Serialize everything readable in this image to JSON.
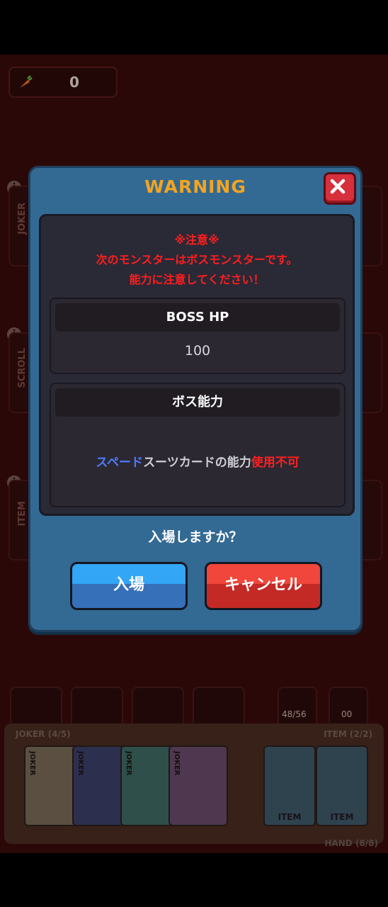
{
  "background": {
    "carrot_count": "0",
    "panels": {
      "joker": "JOKER",
      "scroll": "SCROLL",
      "item": "ITEM"
    },
    "info_icon": "i",
    "deck": {
      "count": "48/56"
    },
    "discard": {
      "count": "00"
    },
    "tray": {
      "joker_title": "JOKER (4/5)",
      "item_title": "ITEM (2/2)",
      "hand_title": "HAND (8/8)",
      "joker_card_label": "JOKER",
      "item_card_label": "ITEM"
    }
  },
  "modal": {
    "title": "WARNING",
    "notice": {
      "line1": "※注意※",
      "line2": "次のモンスターはボスモンスターです。",
      "line3": "能力に注意してください！"
    },
    "boss_hp": {
      "label": "BOSS HP",
      "value": "100"
    },
    "boss_ability": {
      "label": "ボス能力",
      "text_blue": "スペード",
      "text_mid": "スーツカードの能力",
      "text_red": "使用不可"
    },
    "question": "入場しますか？",
    "enter_label": "入場",
    "cancel_label": "キャンセル"
  },
  "colors": {
    "accent_title": "#f4a41f",
    "warning_red": "#ff1e1e",
    "spade_blue": "#4d7bff",
    "modal_bg": "#336a93"
  }
}
